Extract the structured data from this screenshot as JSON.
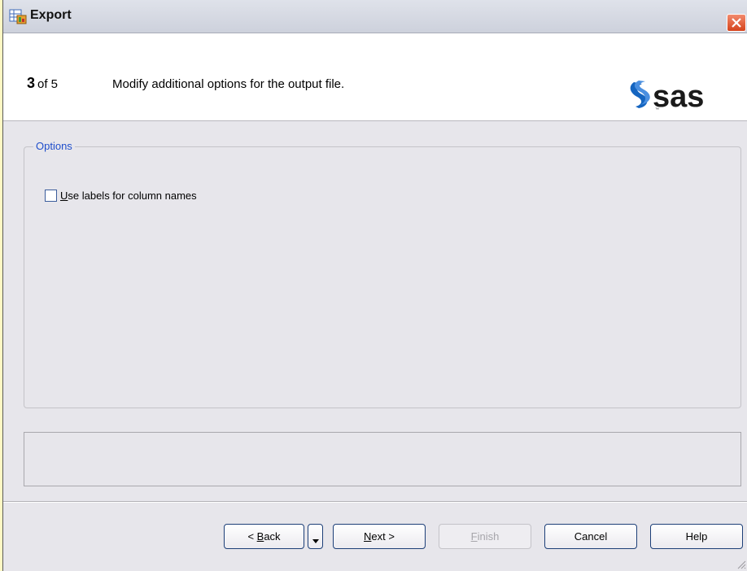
{
  "window": {
    "title": "Export"
  },
  "header": {
    "step_number": "3",
    "step_of": "of 5",
    "description": "Modify additional options for the output file.",
    "logo_text": "sas"
  },
  "options": {
    "legend": "Options",
    "use_labels": {
      "label_mnemonic": "U",
      "label_rest": "se labels for column names",
      "checked": false
    }
  },
  "buttons": {
    "back": {
      "pre": "< ",
      "mnemonic": "B",
      "rest": "ack"
    },
    "next": {
      "mnemonic": "N",
      "rest": "ext >"
    },
    "finish": {
      "mnemonic": "F",
      "rest": "inish"
    },
    "cancel": "Cancel",
    "help": "Help"
  },
  "colors": {
    "accent": "#1f4ecb",
    "logo": "#1565c0",
    "close": "#d5431c"
  }
}
